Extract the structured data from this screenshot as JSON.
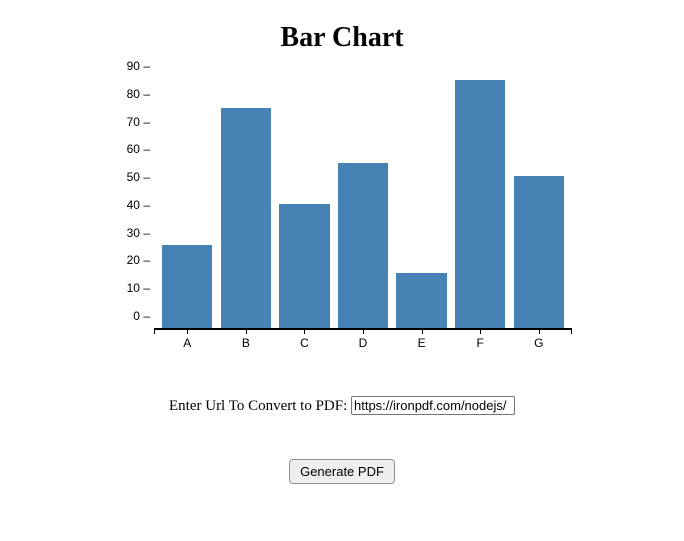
{
  "title": "Bar Chart",
  "chart_data": {
    "type": "bar",
    "categories": [
      "A",
      "B",
      "C",
      "D",
      "E",
      "F",
      "G"
    ],
    "values": [
      30,
      80,
      45,
      60,
      20,
      90,
      55
    ],
    "title": "Bar Chart",
    "xlabel": "",
    "ylabel": "",
    "ylim": [
      0,
      90
    ],
    "y_ticks": [
      0,
      10,
      20,
      30,
      40,
      50,
      60,
      70,
      80,
      90
    ],
    "bar_color": "#4682b4"
  },
  "form": {
    "url_label": "Enter Url To Convert to PDF: ",
    "url_value": "https://ironpdf.com/nodejs/",
    "button_label": "Generate PDF"
  }
}
